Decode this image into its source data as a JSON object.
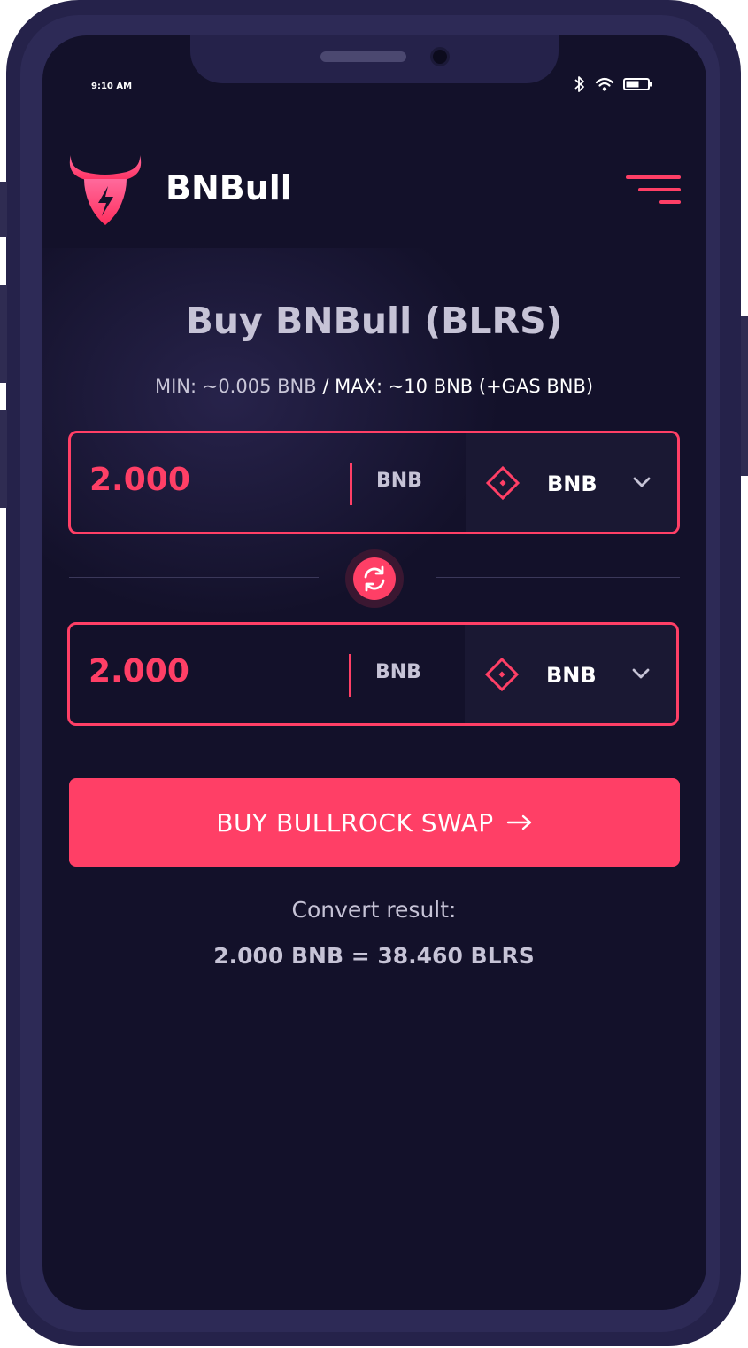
{
  "status_bar": {
    "time": "9:10 AM",
    "icons": [
      "bluetooth-icon",
      "wifi-icon",
      "battery-icon"
    ]
  },
  "header": {
    "brand": "BNBull",
    "logo_icon": "bull-logo-icon",
    "menu_icon": "menu-icon"
  },
  "main": {
    "title": "Buy BNBull (BLRS)",
    "limits": {
      "min": "MIN: ~0.005 BNB",
      "separator": " / ",
      "max": "MAX: ~10 BNB (+GAS BNB)"
    },
    "from": {
      "amount": "2.000",
      "unit": "BNB",
      "token": "BNB",
      "token_icon": "diamond-token-icon"
    },
    "swap_icon": "swap-refresh-icon",
    "to": {
      "amount": "2.000",
      "unit": "BNB",
      "token": "BNB",
      "token_icon": "diamond-token-icon"
    },
    "buy_button": {
      "label": "BUY BULLROCK SWAP",
      "icon": "arrow-right-icon"
    },
    "convert": {
      "label": "Convert result:",
      "value": "2.000 BNB = 38.460 BLRS"
    }
  },
  "colors": {
    "accent": "#ff3f66",
    "background": "#13112a",
    "frame": "#25224a",
    "text_muted": "#c6c3d6"
  }
}
